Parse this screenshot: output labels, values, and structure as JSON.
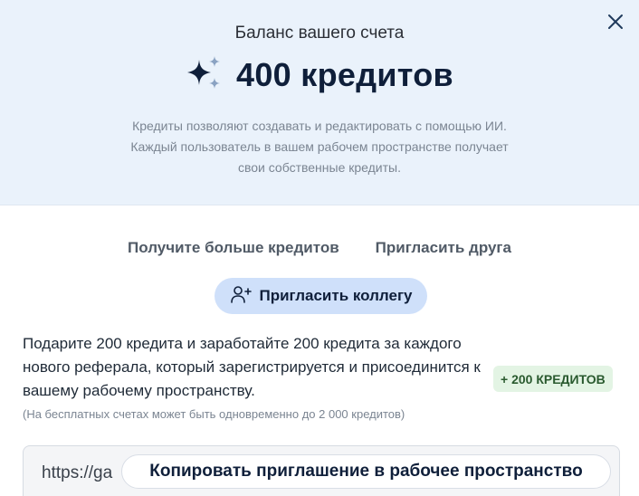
{
  "header": {
    "balance_label": "Баланс вашего счета",
    "amount": "400 кредитов",
    "description": [
      "Кредиты позволяют создавать и редактировать с помощью ИИ.",
      "Каждый пользователь в вашем рабочем пространстве получает",
      "свои собственные кредиты."
    ],
    "close_icon": "close-icon",
    "sparkle_icon": "sparkles-icon"
  },
  "tabs": [
    {
      "label": "Получите больше кредитов"
    },
    {
      "label": "Пригласить друга"
    }
  ],
  "invite": {
    "button_label": "Пригласить коллегу",
    "icon": "add-user-icon",
    "gift_text": "Подарите 200 кредита и заработайте 200 кредита за каждого нового реферала, который зарегистрируется и присоединится к вашему рабочему пространству.",
    "note": "(На бесплатных счетах может быть одновременно до 2 000 кредитов)",
    "badge": "+ 200 КРЕДИТОВ"
  },
  "link": {
    "url_prefix": "https://ga",
    "copy_label": "Копировать приглашение в рабочее пространство"
  },
  "colors": {
    "header_bg": "#eaf2fb",
    "accent_button": "#cfe0fa",
    "badge_bg": "#e3f4e4",
    "badge_text": "#2a5a2f",
    "navy": "#0f1f3a"
  }
}
